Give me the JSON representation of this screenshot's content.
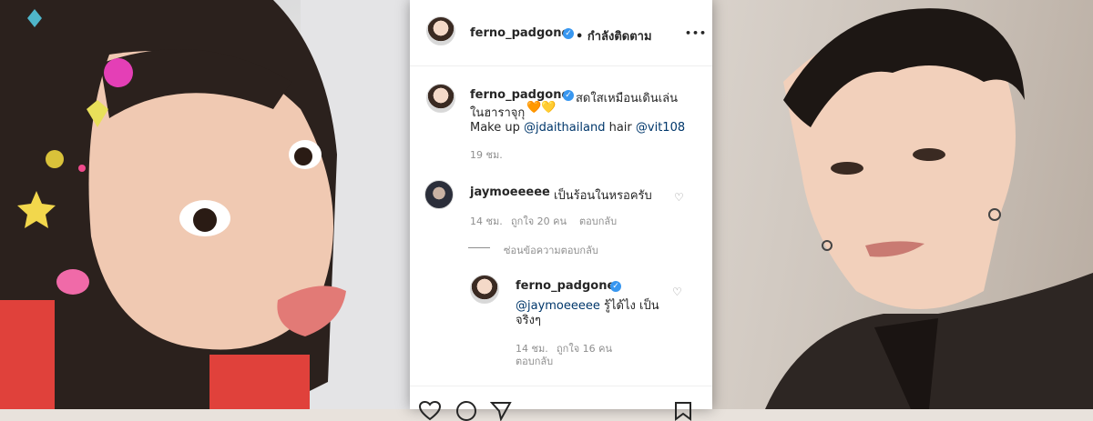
{
  "header": {
    "username": "ferno_padgone",
    "follow_status": "• กำลังติดตาม",
    "more_label": "•••"
  },
  "caption": {
    "username": "ferno_padgone",
    "text_line1": "สดใสเหมือนเดินเล่น",
    "text_line2": "ในฮาราจุกุ",
    "hearts": "🧡💛",
    "text_line3_prefix": "Make up",
    "mention1": "@jdaithailand",
    "text_line3_mid": "hair",
    "mention2": "@vit108",
    "time": "19 ชม."
  },
  "comment": {
    "username": "jaymoeeeee",
    "text": "เป็นร้อนในหรอครับ",
    "time": "14 ชม.",
    "likes": "ถูกใจ 20 คน",
    "reply_label": "ตอบกลับ",
    "hide_replies": "ซ่อนข้อความตอบกลับ"
  },
  "reply": {
    "username": "ferno_padgone",
    "mention": "@jaymoeeeee",
    "text_line1": "รู้ได้ไง เป็น",
    "text_line2": "จริงๆ",
    "time": "14 ชม.",
    "likes": "ถูกใจ 16 คน",
    "reply_label": "ตอบกลับ"
  },
  "icons": {
    "like": "heart-outline-icon",
    "comment": "comment-icon",
    "share": "share-icon",
    "save": "bookmark-icon"
  },
  "colors": {
    "accent_verified": "#3897f0",
    "link": "#00376b",
    "meta": "#8e8e8e"
  }
}
